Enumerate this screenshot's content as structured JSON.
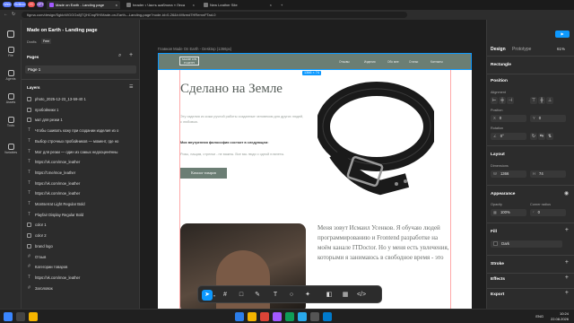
{
  "browser": {
    "pills": [
      {
        "label": "Web",
        "color": "#5b7cff"
      },
      {
        "label": "Skillbox",
        "color": "#5b7cff"
      },
      {
        "label": "УС",
        "color": "#ef5350"
      },
      {
        "label": "GPT",
        "color": "#7e57c2"
      }
    ],
    "tabs": [
      {
        "title": "Made on Earth - Landing page",
        "color": "#a259ff",
        "active": true
      },
      {
        "title": "header • Часть шаблона « Леса",
        "color": "#777777",
        "active": false
      },
      {
        "title": "New Leather Site",
        "color": "#777777",
        "active": false
      }
    ],
    "url": "figma.com/design/SgklcWGGGx8jTQHCnqRH/Made-on-Earth---Landing-page?node-id=0-26&t=Mfzmd7HRemnFTad-0"
  },
  "rail": [
    "File",
    "Agents",
    "Assets",
    "Tools",
    "Variables"
  ],
  "file": {
    "title": "Made on Earth - Landing page",
    "drafts": "Drafts",
    "plan": "Free"
  },
  "pages": {
    "header": "Pages",
    "items": [
      "Page 1"
    ]
  },
  "layers": {
    "header": "Layers",
    "items": [
      {
        "label": "photo_2025-12-23_13-59-40 1",
        "kind": "img"
      },
      {
        "label": "пробойники 1",
        "kind": "img"
      },
      {
        "label": "мат для резки 1",
        "kind": "img"
      },
      {
        "label": "Чтобы сшивать кожу при создании изделия из о",
        "kind": "txt"
      },
      {
        "label": "Выбор строчных пробойников — момент, где но",
        "kind": "txt"
      },
      {
        "label": "Мат для резки — один из самых недооценённы",
        "kind": "txt"
      },
      {
        "label": "https://vk.com/moe_leather",
        "kind": "txt"
      },
      {
        "label": "https://t.me/moe_leather",
        "kind": "txt"
      },
      {
        "label": "https://vk.com/moe_leather",
        "kind": "txt"
      },
      {
        "label": "https://vk.com/moe_leather",
        "kind": "txt"
      },
      {
        "label": "Montserrat Light Regular Bold",
        "kind": "txt"
      },
      {
        "label": "Playfair Display Regular Bold",
        "kind": "txt"
      },
      {
        "label": "color 1",
        "kind": "img"
      },
      {
        "label": "color 2",
        "kind": "img"
      },
      {
        "label": "brand logo",
        "kind": "img"
      },
      {
        "label": "Отзыв",
        "kind": "frm"
      },
      {
        "label": "Категории товаров",
        "kind": "frm"
      },
      {
        "label": "https://vk.com/moe_leather",
        "kind": "txt"
      },
      {
        "label": "Заголовок",
        "kind": "frm"
      }
    ]
  },
  "canvas": {
    "frame_label": "Главная Made On Earth - Desktop (1366px)",
    "selection_size": "1366 × 74",
    "site": {
      "logo": "MADE ON EARTH",
      "nav": [
        "Отзывы",
        "Изделия",
        "Обо мне",
        "Статьи",
        "Контакты"
      ],
      "title": "Сделано на Земле",
      "p1": "Эту изделия из кожи ручной работы созданные человеком для других людей, с любовью.",
      "bold": "Моя внутренняя философия состоит в следующем:",
      "p2": "Ризы, нащим, стрелки - не важны. Все мы люди с одной планеты.",
      "cta": "Каталог товаров",
      "about": "Меня зовут Исмаил Усенков. Я обучаю людей программированию и Frontend разработке на моём канале ITDoctor. Но у меня есть увлечения, которыми я занимаюсь в свободное время - это"
    }
  },
  "toolbar": [
    "move",
    "frame",
    "shape",
    "pen",
    "text",
    "comment",
    "actions",
    "dev",
    "code"
  ],
  "right": {
    "tabs": [
      "Design",
      "Prototype"
    ],
    "zoom": "61%",
    "element": "Rectangle",
    "position": "Position",
    "alignment": "Alignment",
    "pos_label": "Position",
    "x": "0",
    "y": "0",
    "rotation_label": "Rotation",
    "rotation": "0°",
    "layout": "Layout",
    "dimensions": "Dimensions",
    "w": "1366",
    "h": "74",
    "appearance": "Appearance",
    "opacity_label": "Opacity",
    "opacity": "100%",
    "radius_label": "Corner radius",
    "radius": "0",
    "fill": "Fill",
    "fill_name": "Dark",
    "fill_color": "#2b2b2b",
    "stroke": "Stroke",
    "effects": "Effects",
    "export": "Export"
  },
  "taskbar": {
    "lang": "ENG",
    "time": "10:24",
    "date": "22.08.2026"
  }
}
